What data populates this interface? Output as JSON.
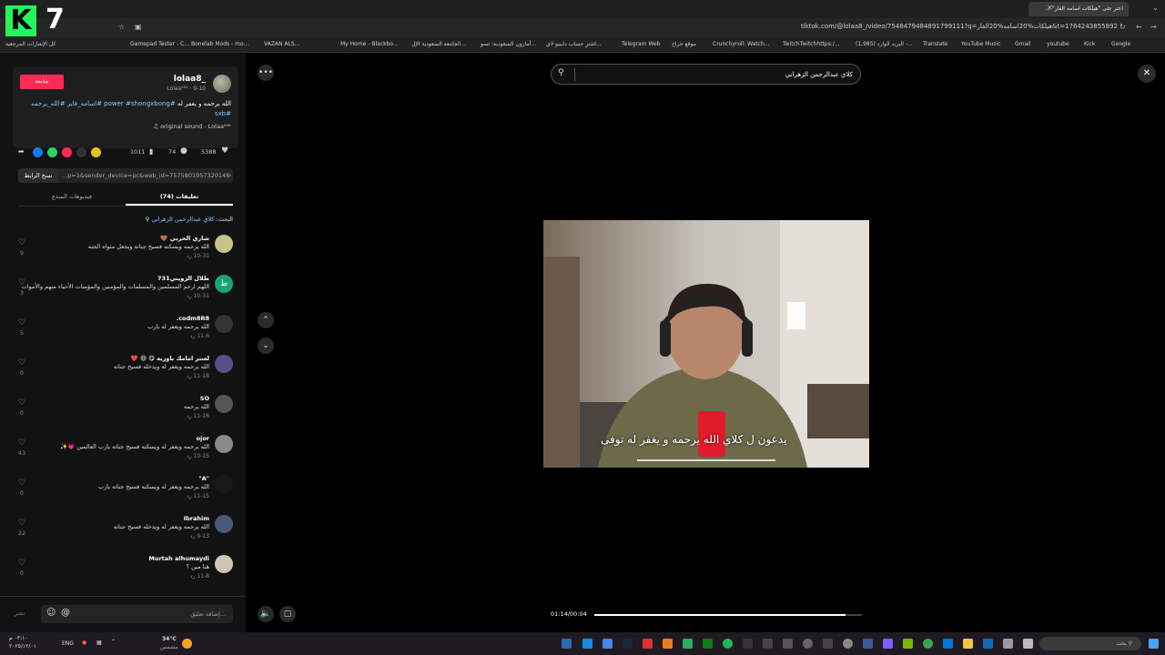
{
  "browser": {
    "tab_title": "اعثر على \"هيلكات اسامه الفار\" ...",
    "url": "tiktok.com/@lolaa8_/video/7548479484891799111?q=هيلكات%20اسامه%20الفار&t=1764243855892",
    "bookmarks": [
      "كل الإشارات المرجعية",
      "Gamepad Tester - C...",
      "Bonelab Mods - mo...",
      "VAZAN ALS...",
      "My Home - Blackbo...",
      "الجامعة السعودية الإل...",
      "أمازون السعودية: تسو...",
      "اشترِ حساب دايبيو لاي...",
      "Telegram Web",
      "موقع حراج",
      "Crunchyroll: Watch...",
      "TwitchTwitchhttps:/...",
      "(1,985) البريد الوارد -...",
      "Translate",
      "YouTube Music",
      "Gmail",
      "youtube",
      "Kick",
      "Google"
    ]
  },
  "logo": {
    "letter": "K",
    "number": "7",
    "color": "#25f45a"
  },
  "post": {
    "username": "lolaa8_",
    "subname": "Lolaa²ᴹᵗ · 9-10",
    "follow_label": "متابعة",
    "description_text": "الله يرحمه و يغفر له",
    "description_tags": "#power #shongxbong #اسامه_فايز #الله_يرحمه #sxb",
    "sound": "original sound - Lolaa²ᴹᵗ",
    "likes": "5388",
    "comments": "74",
    "saves": "1011",
    "copy_link_label": "نسخ الرابط",
    "link": "...p=1&sender_device=pc&web_id=7575801957320148497",
    "tab_comments": "(74) تعليقات",
    "tab_creator_videos": "فيديوهات المبدع",
    "search_prefix": "البحث:",
    "search_term": "كلاي عبدالرحمن الزهراني"
  },
  "comments": [
    {
      "name": "شاري الحربي 🤎",
      "text": "الله يرحمه ويسكنه فسيح جناته ويجعل مثواه الجنه",
      "meta": "10-31  رد",
      "likes": "9",
      "avatar_color": "#c9c38a"
    },
    {
      "name": "طلال الزويني731",
      "text": "اللهم ارحم المسلمين والمسلمات والمؤمنين والمؤمنات الأحياء منهم والأموات",
      "meta": "10-31  رد",
      "likes": "3",
      "avatar_color": "#1aa37a"
    },
    {
      "name": "codm8R8.",
      "text": "الله يرحمه ويغفر له يارب",
      "meta": "11-6  رد",
      "likes": "5",
      "avatar_color": "#333333"
    },
    {
      "name": "لعنتر امامك باوزيه 😋 😆 ❤️",
      "text": "الله يرحمه ويغفر له ويدخله فسيح جناته",
      "meta": "11-18  رد",
      "likes": "0",
      "avatar_color": "#5a4f8a"
    },
    {
      "name": "SO",
      "text": "الله يرحمه",
      "meta": "11-16  رد",
      "likes": "0",
      "avatar_color": "#555555"
    },
    {
      "name": "ojor",
      "text": "الله يرحمه ويغفر له ويسكنه فسيح جناته يارب العالمين 💗✨",
      "meta": "10-15  رد",
      "likes": "43",
      "avatar_color": "#8a8a8a"
    },
    {
      "name": "\"A\"",
      "text": "الله يرحمه ويغفر له ويسكنه فسيح جناته يارب",
      "meta": "11-15  رد",
      "likes": "0",
      "avatar_color": "#1a1a1a"
    },
    {
      "name": "Ibrahim",
      "text": "الله يرحمه ويغفر له ويدخله فسيح جناته",
      "meta": "9-13  رد",
      "likes": "22",
      "avatar_color": "#4c5a7a"
    },
    {
      "name": "Murtah alhumaydi",
      "text": "هنا مين ؟",
      "meta": "11-8  رد",
      "likes": "0",
      "avatar_color": "#cfc7b5"
    }
  ],
  "comment_input": {
    "placeholder": "إضافة تعليق...",
    "post_label": "نشر"
  },
  "video": {
    "search_value": "كلاي عبدالرحمن الزهراني",
    "subtitle": "يدعون ل كلاي الله يرحمه و يغفر له توفى",
    "time": "01:14/00:04",
    "progress": 0.94
  },
  "taskbar": {
    "search_placeholder": "بحث",
    "weather_temp": "34°C",
    "weather_desc": "مشمس",
    "lang": "ENG",
    "time": "٠٣:١٠ م",
    "date": "٢٠٢٥/١٢/٠١"
  }
}
